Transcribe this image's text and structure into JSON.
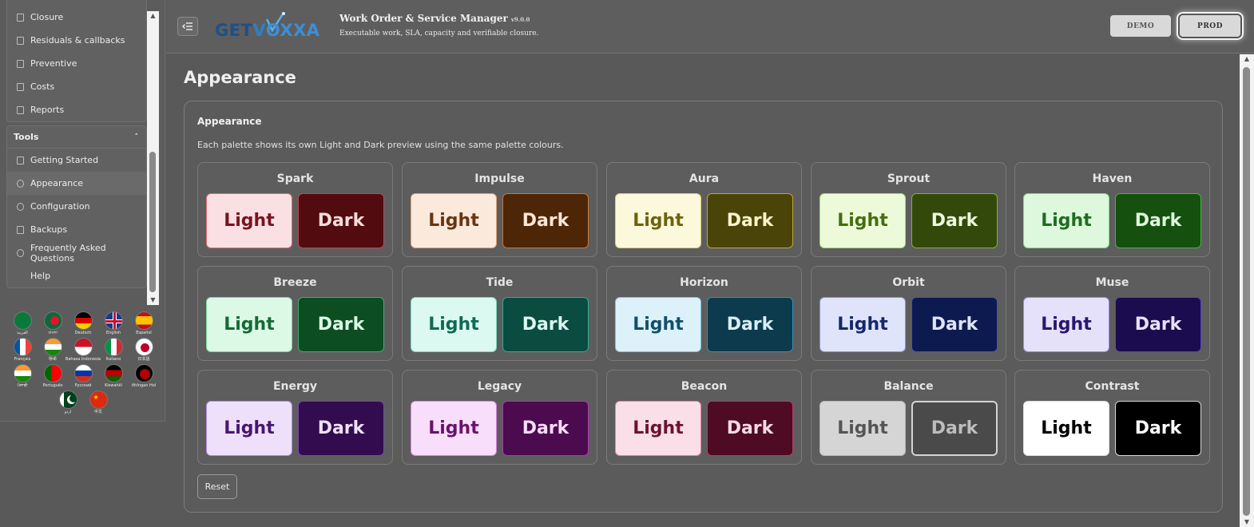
{
  "sidebar": {
    "items_top": [
      {
        "label": "Closure",
        "icon": "doc-icon"
      },
      {
        "label": "Residuals & callbacks",
        "icon": "doc-icon"
      },
      {
        "label": "Preventive",
        "icon": "doc-icon"
      },
      {
        "label": "Costs",
        "icon": "doc-icon"
      },
      {
        "label": "Reports",
        "icon": "doc-icon"
      }
    ],
    "tools_header": "Tools",
    "tools_caret": "˄",
    "tools_items": [
      {
        "label": "Getting Started",
        "icon": "launch-icon"
      },
      {
        "label": "Appearance",
        "icon": "palette-icon",
        "active": true
      },
      {
        "label": "Configuration",
        "icon": "gear-icon"
      },
      {
        "label": "Backups",
        "icon": "upload-icon"
      },
      {
        "label": "Frequently Asked Questions",
        "icon": "help-circle-icon"
      },
      {
        "label": "Help",
        "icon": "none"
      }
    ],
    "languages": [
      [
        "العربية",
        "বাংলা",
        "Deutsch",
        "English",
        "Español"
      ],
      [
        "Français",
        "हिन्दी",
        "Bahasa Indonesia",
        "Italiano",
        "日本語"
      ],
      [
        "ਪੰਜਾਬੀ",
        "Português",
        "Русский",
        "Kiswahili",
        "tlhIngan Hol"
      ],
      [
        "اردو",
        "中文"
      ]
    ]
  },
  "header": {
    "collapse_icon": "sidebar-collapse-icon",
    "logo_text": [
      "GET",
      "V",
      "OXXA"
    ],
    "title": "Work Order & Service Manager",
    "version": "v9.0.0",
    "subtitle": "Executable work, SLA, capacity and verifiable closure.",
    "env_demo": "DEMO",
    "env_prod": "PROD"
  },
  "main": {
    "page_title": "Appearance",
    "card_title": "Appearance",
    "card_description": "Each palette shows its own Light and Dark preview using the same palette colours.",
    "light_label": "Light",
    "dark_label": "Dark",
    "reset_label": "Reset",
    "palettes": [
      {
        "name": "Spark",
        "light_bg": "#fbe0e3",
        "light_fg": "#7a1321",
        "light_border": "#e06a78",
        "dark_bg": "#520b0f",
        "dark_fg": "#f8dcdc",
        "dark_border": "#c0454f"
      },
      {
        "name": "Impulse",
        "light_bg": "#fbe9dc",
        "light_fg": "#6b3410",
        "light_border": "#e0a178",
        "dark_bg": "#4d2608",
        "dark_fg": "#fbe6d6",
        "dark_border": "#c47a3e"
      },
      {
        "name": "Aura",
        "light_bg": "#fbf8dc",
        "light_fg": "#6d6210",
        "light_border": "#d9cf70",
        "dark_bg": "#4b4408",
        "dark_fg": "#faf4cc",
        "dark_border": "#b9aa33"
      },
      {
        "name": "Sprout",
        "light_bg": "#ecfad9",
        "light_fg": "#466d12",
        "light_border": "#a7d874",
        "dark_bg": "#33490c",
        "dark_fg": "#eef9dc",
        "dark_border": "#82b13b"
      },
      {
        "name": "Haven",
        "light_bg": "#ddf8dd",
        "light_fg": "#1e6d1e",
        "light_border": "#86d886",
        "dark_bg": "#15500f",
        "dark_fg": "#e0f8de",
        "dark_border": "#4cb04a"
      },
      {
        "name": "Breeze",
        "light_bg": "#dcf9e6",
        "light_fg": "#156b34",
        "light_border": "#7fd8a0",
        "dark_bg": "#0c4e22",
        "dark_fg": "#dcf8e6",
        "dark_border": "#3fae68"
      },
      {
        "name": "Tide",
        "light_bg": "#dbf9f1",
        "light_fg": "#0f6a55",
        "light_border": "#78d8c0",
        "dark_bg": "#0a4c40",
        "dark_fg": "#d9f8ef",
        "dark_border": "#35ab90"
      },
      {
        "name": "Horizon",
        "light_bg": "#dcf1fa",
        "light_fg": "#124f6a",
        "light_border": "#7fc2df",
        "dark_bg": "#0c3b4d",
        "dark_fg": "#d9eef8",
        "dark_border": "#3b8fb0"
      },
      {
        "name": "Orbit",
        "light_bg": "#dfe4fa",
        "light_fg": "#16286b",
        "light_border": "#8594dd",
        "dark_bg": "#0d1a4f",
        "dark_fg": "#dfe3f8",
        "dark_border": "#4257b3"
      },
      {
        "name": "Muse",
        "light_bg": "#e6e1fa",
        "light_fg": "#2a1670",
        "light_border": "#9a8be0",
        "dark_bg": "#1b0c4f",
        "dark_fg": "#e6e1f8",
        "dark_border": "#5a44b5"
      },
      {
        "name": "Energy",
        "light_bg": "#eee0fa",
        "light_fg": "#4a1670",
        "light_border": "#b18be0",
        "dark_bg": "#330c4f",
        "dark_fg": "#efe1f8",
        "dark_border": "#7a44b5"
      },
      {
        "name": "Legacy",
        "light_bg": "#f8defa",
        "light_fg": "#6a126d",
        "light_border": "#d884db",
        "dark_bg": "#4c0a4f",
        "dark_fg": "#f6dcf8",
        "dark_border": "#a23fae"
      },
      {
        "name": "Beacon",
        "light_bg": "#fadfe8",
        "light_fg": "#6d1233",
        "light_border": "#dd84a4",
        "dark_bg": "#4f0a24",
        "dark_fg": "#f8dbe5",
        "dark_border": "#ae3f66"
      },
      {
        "name": "Balance",
        "light_bg": "#d5d5d5",
        "light_fg": "#555555",
        "light_border": "#b5b5b5",
        "dark_bg": "#4a4a4a",
        "dark_fg": "#bdbdbd",
        "dark_border": "#d4d4d4"
      },
      {
        "name": "Contrast",
        "light_bg": "#ffffff",
        "light_fg": "#000000",
        "light_border": "#e0e0e0",
        "dark_bg": "#000000",
        "dark_fg": "#ffffff",
        "dark_border": "#d8d8d8"
      }
    ]
  }
}
